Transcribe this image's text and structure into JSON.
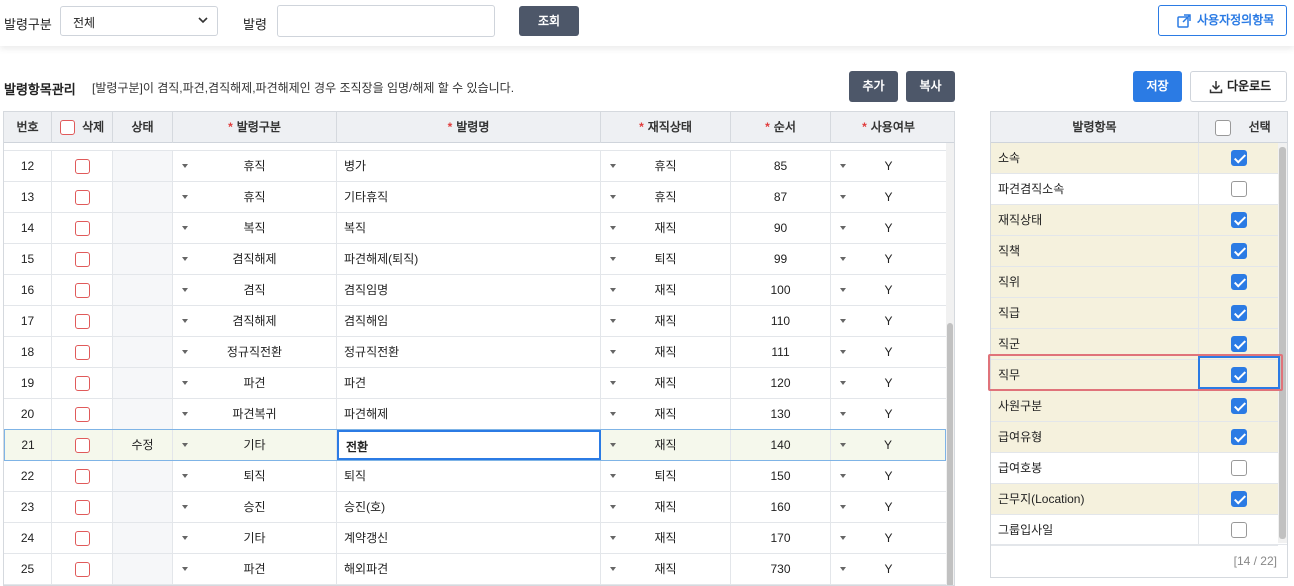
{
  "filter": {
    "type_label": "발령구분",
    "type_value": "전체",
    "order_label": "발령",
    "order_value": "",
    "search_button": "조회",
    "custom_button": "사용자정의항목"
  },
  "section": {
    "title": "발령항목관리",
    "description": "[발령구분]이 겸직,파견,겸직해제,파견해제인 경우 조직장을 임명/해제 할 수 있습니다.",
    "add_button": "추가",
    "copy_button": "복사",
    "save_button": "저장",
    "download_button": "다운로드"
  },
  "grid": {
    "headers": {
      "no": "번호",
      "delete": "삭제",
      "state": "상태",
      "type": "발령구분",
      "name": "발령명",
      "status": "재직상태",
      "order": "순서",
      "use": "사용여부",
      "required_mark": "*"
    },
    "rows": [
      {
        "no": "12",
        "state": "",
        "type": "휴직",
        "name": "병가",
        "status": "휴직",
        "order": "85",
        "use": "Y"
      },
      {
        "no": "13",
        "state": "",
        "type": "휴직",
        "name": "기타휴직",
        "status": "휴직",
        "order": "87",
        "use": "Y"
      },
      {
        "no": "14",
        "state": "",
        "type": "복직",
        "name": "복직",
        "status": "재직",
        "order": "90",
        "use": "Y"
      },
      {
        "no": "15",
        "state": "",
        "type": "겸직해제",
        "name": "파견해제(퇴직)",
        "status": "퇴직",
        "order": "99",
        "use": "Y"
      },
      {
        "no": "16",
        "state": "",
        "type": "겸직",
        "name": "겸직임명",
        "status": "재직",
        "order": "100",
        "use": "Y"
      },
      {
        "no": "17",
        "state": "",
        "type": "겸직해제",
        "name": "겸직해임",
        "status": "재직",
        "order": "110",
        "use": "Y"
      },
      {
        "no": "18",
        "state": "",
        "type": "정규직전환",
        "name": "정규직전환",
        "status": "재직",
        "order": "111",
        "use": "Y"
      },
      {
        "no": "19",
        "state": "",
        "type": "파견",
        "name": "파견",
        "status": "재직",
        "order": "120",
        "use": "Y"
      },
      {
        "no": "20",
        "state": "",
        "type": "파견복귀",
        "name": "파견해제",
        "status": "재직",
        "order": "130",
        "use": "Y"
      },
      {
        "no": "21",
        "state": "수정",
        "type": "기타",
        "name": "전환",
        "status": "재직",
        "order": "140",
        "use": "Y"
      },
      {
        "no": "22",
        "state": "",
        "type": "퇴직",
        "name": "퇴직",
        "status": "퇴직",
        "order": "150",
        "use": "Y"
      },
      {
        "no": "23",
        "state": "",
        "type": "승진",
        "name": "승진(호)",
        "status": "재직",
        "order": "160",
        "use": "Y"
      },
      {
        "no": "24",
        "state": "",
        "type": "기타",
        "name": "계약갱신",
        "status": "재직",
        "order": "170",
        "use": "Y"
      },
      {
        "no": "25",
        "state": "",
        "type": "파견",
        "name": "해외파견",
        "status": "재직",
        "order": "730",
        "use": "Y"
      }
    ]
  },
  "items_panel": {
    "header_name": "발령항목",
    "header_select": "선택",
    "items": [
      {
        "name": "소속",
        "checked": true
      },
      {
        "name": "파견겸직소속",
        "checked": false
      },
      {
        "name": "재직상태",
        "checked": true
      },
      {
        "name": "직책",
        "checked": true
      },
      {
        "name": "직위",
        "checked": true
      },
      {
        "name": "직급",
        "checked": true
      },
      {
        "name": "직군",
        "checked": true
      },
      {
        "name": "직무",
        "checked": true
      },
      {
        "name": "사원구분",
        "checked": true
      },
      {
        "name": "급여유형",
        "checked": true
      },
      {
        "name": "급여호봉",
        "checked": false
      },
      {
        "name": "근무지(Location)",
        "checked": true
      },
      {
        "name": "그룹입사일",
        "checked": false
      }
    ],
    "pager": "[14 / 22]"
  },
  "colors": {
    "accent": "#2b7be4",
    "dark_button": "#4d5769",
    "required": "#e03c3c",
    "highlight": "#e0737a"
  }
}
